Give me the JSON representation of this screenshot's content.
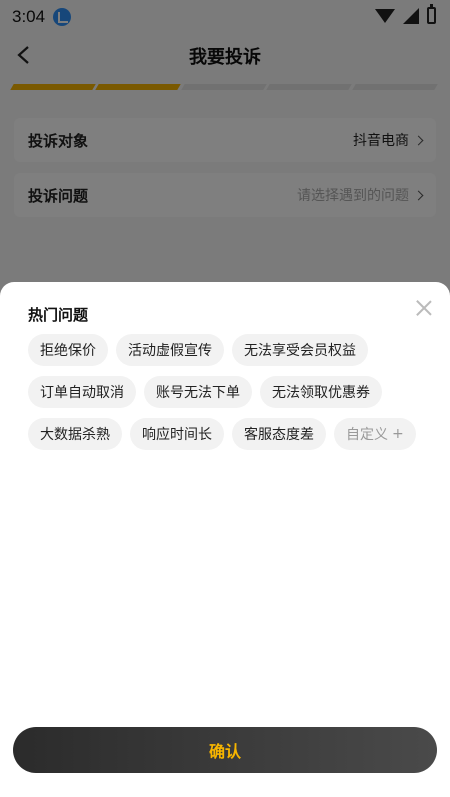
{
  "status_bar": {
    "time": "3:04"
  },
  "header": {
    "title": "我要投诉"
  },
  "progress": {
    "segments": 5,
    "completed": 2,
    "accent": "#f5b300"
  },
  "form": {
    "target": {
      "label": "投诉对象",
      "value": "抖音电商"
    },
    "issue": {
      "label": "投诉问题",
      "placeholder": "请选择遇到的问题"
    }
  },
  "sheet": {
    "title": "热门问题",
    "tags": [
      "拒绝保价",
      "活动虚假宣传",
      "无法享受会员权益",
      "订单自动取消",
      "账号无法下单",
      "无法领取优惠券",
      "大数据杀熟",
      "响应时间长",
      "客服态度差"
    ],
    "custom_tag": "自定义",
    "custom_plus": "+",
    "confirm_label": "确认"
  }
}
